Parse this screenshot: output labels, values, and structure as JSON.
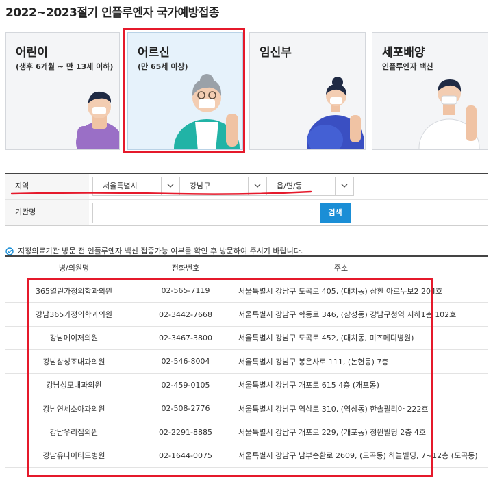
{
  "page": {
    "title": "2022~2023절기 인플루엔자 국가예방접종"
  },
  "cards": [
    {
      "title": "어린이",
      "sub": "(생후 6개월 ~ 만 13세 이하)",
      "shirt": "#9a6fc6"
    },
    {
      "title": "어르신",
      "sub": "(만 65세 이상)",
      "shirt": "#21b3a6"
    },
    {
      "title": "임신부",
      "sub": "",
      "shirt": "#3a4fc2"
    },
    {
      "title": "세포배양",
      "sub": "인플루엔자 백신",
      "shirt": "#ffffff"
    }
  ],
  "form": {
    "region_label": "지역",
    "sido": "서울특별시",
    "gu": "강남구",
    "dong": "읍/면/동",
    "name_label": "기관명",
    "search_label": "검색"
  },
  "notice": "지정의료기관 방문 전 인플루엔자 백신 접종가능 여부를 확인 후 방문하여 주시기 바랍니다.",
  "table": {
    "headers": [
      "병/의원명",
      "전화번호",
      "주소"
    ],
    "rows": [
      [
        "365열린가정의학과의원",
        "02-565-7119",
        "서울특별시 강남구 도곡로 405, (대치동) 삼환 아르누보2 204호"
      ],
      [
        "강남365가정의학과의원",
        "02-3442-7668",
        "서울특별시 강남구 학동로 346, (삼성동) 강남구청역 지하1층 102호"
      ],
      [
        "강남메이저의원",
        "02-3467-3800",
        "서울특별시 강남구 도곡로 452, (대치동, 미즈메디병원)"
      ],
      [
        "강남삼성조내과의원",
        "02-546-8004",
        "서울특별시 강남구 봉은사로 111, (논현동) 7층"
      ],
      [
        "강남성모내과의원",
        "02-459-0105",
        "서울특별시 강남구 개포로 615 4층 (개포동)"
      ],
      [
        "강남연세소아과의원",
        "02-508-2776",
        "서울특별시 강남구 역삼로 310, (역삼동) 한솔필리아 222호"
      ],
      [
        "강남우리집의원",
        "02-2291-8885",
        "서울특별시 강남구 개포로 229, (개포동) 정원빌딩 2층 4호"
      ],
      [
        "강남유나이티드병원",
        "02-1644-0075",
        "서울특별시 강남구 남부순환로 2609, (도곡동) 하늘빌딩, 7~12층 (도곡동)"
      ]
    ]
  },
  "colors": {
    "accent": "#1a8ed6",
    "highlight": "#e5192b",
    "selected_card": "#e6f2fb"
  }
}
